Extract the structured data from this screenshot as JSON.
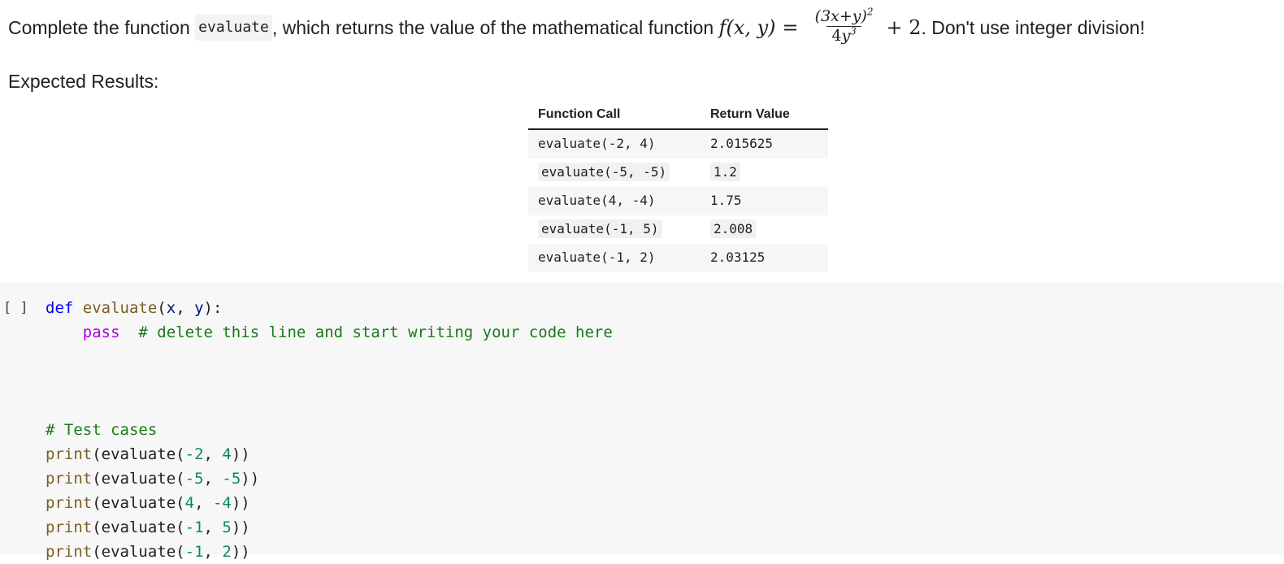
{
  "prose": {
    "intro_before": "Complete the function ",
    "intro_code": "evaluate",
    "intro_middle": ", which returns the value of the mathematical function ",
    "formula": {
      "lhs": "f(x, y)",
      "equals": "=",
      "numerator": "(3x+y)",
      "numerator_exp": "2",
      "denominator_coeff": "4",
      "denominator_var": "y",
      "denominator_exp": "3",
      "plus": "+ 2",
      "text": "f(x, y) = (3x+y)^2 / (4y^3) + 2"
    },
    "intro_after": ". Don't use integer division!",
    "expected_label": "Expected Results:"
  },
  "table": {
    "headers": [
      "Function Call",
      "Return Value"
    ],
    "rows": [
      {
        "call": "evaluate(-2, 4)",
        "value": "2.015625"
      },
      {
        "call": "evaluate(-5, -5)",
        "value": "1.2"
      },
      {
        "call": "evaluate(4, -4)",
        "value": "1.75"
      },
      {
        "call": "evaluate(-1, 5)",
        "value": "2.008"
      },
      {
        "call": "evaluate(-1, 2)",
        "value": "2.03125"
      }
    ]
  },
  "cell": {
    "run_marker": "[ ]",
    "code_lines": [
      "def evaluate(x, y):",
      "    pass  # delete this line and start writing your code here",
      "",
      "",
      "# Test cases",
      "print(evaluate(-2, 4))",
      "print(evaluate(-5, -5))",
      "print(evaluate(4, -4))",
      "print(evaluate(-1, 5))",
      "print(evaluate(-1, 2))"
    ],
    "tokens": {
      "def": "def",
      "fn_name": "evaluate",
      "param_x": "x",
      "param_y": "y",
      "pass": "pass",
      "comment_hint": "# delete this line and start writing your code here",
      "comment_tests": "# Test cases",
      "print": "print",
      "call_name": "evaluate"
    },
    "calls": [
      {
        "a": "-2",
        "b": "4"
      },
      {
        "a": "-5",
        "b": "-5"
      },
      {
        "a": "4",
        "b": "-4"
      },
      {
        "a": "-1",
        "b": "5"
      },
      {
        "a": "-1",
        "b": "2"
      }
    ]
  },
  "colors": {
    "keyword": "#0000ff",
    "function": "#795e26",
    "param": "#001080",
    "pass": "#af00db",
    "comment": "#1a7a1a",
    "number": "#09885a",
    "cell_bg": "#f7f7f7",
    "row_stripe": "#f6f6f6",
    "code_span_bg": "#f1f3f4"
  }
}
